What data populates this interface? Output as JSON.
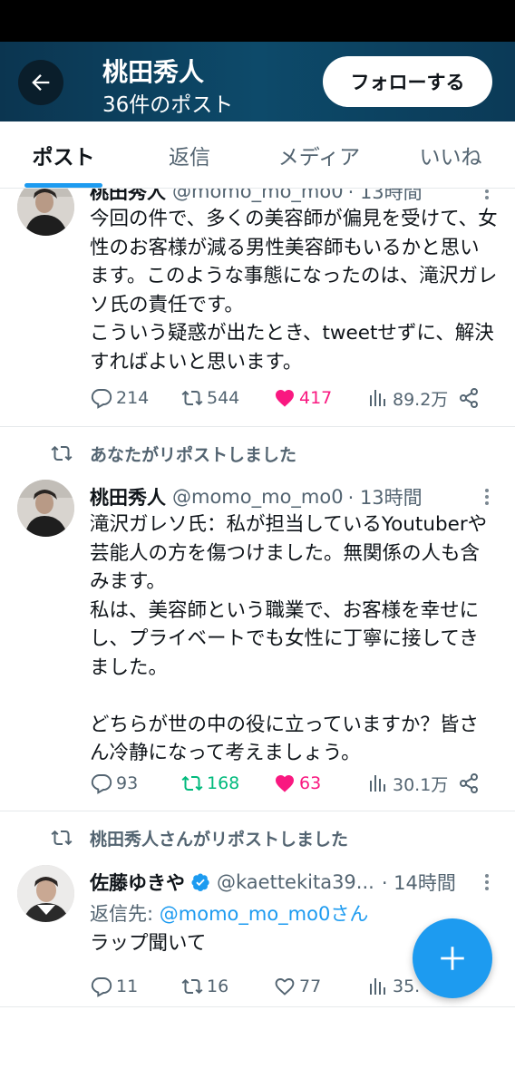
{
  "header": {
    "name": "桃田秀人",
    "post_count": "36件のポスト",
    "follow_label": "フォローする"
  },
  "tabs": [
    {
      "label": "ポスト",
      "active": true
    },
    {
      "label": "返信",
      "active": false
    },
    {
      "label": "メディア",
      "active": false
    },
    {
      "label": "いいね",
      "active": false
    }
  ],
  "posts": [
    {
      "author": "桃田秀人",
      "handle": "@momo_mo_mo0",
      "time": "· 13時間",
      "text": "今回の件で、多くの美容師が偏見を受けて、女性のお客様が減る男性美容師もいるかと思います。このような事態になったのは、滝沢ガレソ氏の責任です。\nこういう疑惑が出たとき、tweetせずに、解決すればよいと思います。",
      "replies": "214",
      "reposts": "544",
      "likes": "417",
      "views": "89.2万",
      "liked": true,
      "reposted": false
    },
    {
      "repost_label": "あなたがリポストしました",
      "author": "桃田秀人",
      "handle": "@momo_mo_mo0",
      "time": "· 13時間",
      "text": "滝沢ガレソ氏：私が担当しているYoutuberや芸能人の方を傷つけました。無関係の人も含みます。\n私は、美容師という職業で、お客様を幸せにし、プライベートでも女性に丁寧に接してきました。\n\nどちらが世の中の役に立っていますか？皆さん冷静になって考えましょう。",
      "replies": "93",
      "reposts": "168",
      "likes": "63",
      "views": "30.1万",
      "liked": true,
      "reposted": true
    },
    {
      "repost_label": "桃田秀人さんがリポストしました",
      "author": "佐藤ゆきや",
      "handle": "@kaettekita39...",
      "time": "· 14時間",
      "reply_prefix": "返信先: ",
      "reply_target": "@momo_mo_mo0さん",
      "text": "ラップ聞いて",
      "replies": "11",
      "reposts": "16",
      "likes": "77",
      "views": "35.",
      "liked": false,
      "reposted": false
    }
  ],
  "colors": {
    "accent": "#1d9bf0",
    "like": "#f91880",
    "repost_active": "#00ba7c",
    "header_bg": "#0d4a6a"
  },
  "icons": [
    "back-arrow-icon",
    "more-icon",
    "reply-icon",
    "repost-icon",
    "like-icon",
    "views-icon",
    "share-icon",
    "verified-icon",
    "compose-plus-icon"
  ]
}
